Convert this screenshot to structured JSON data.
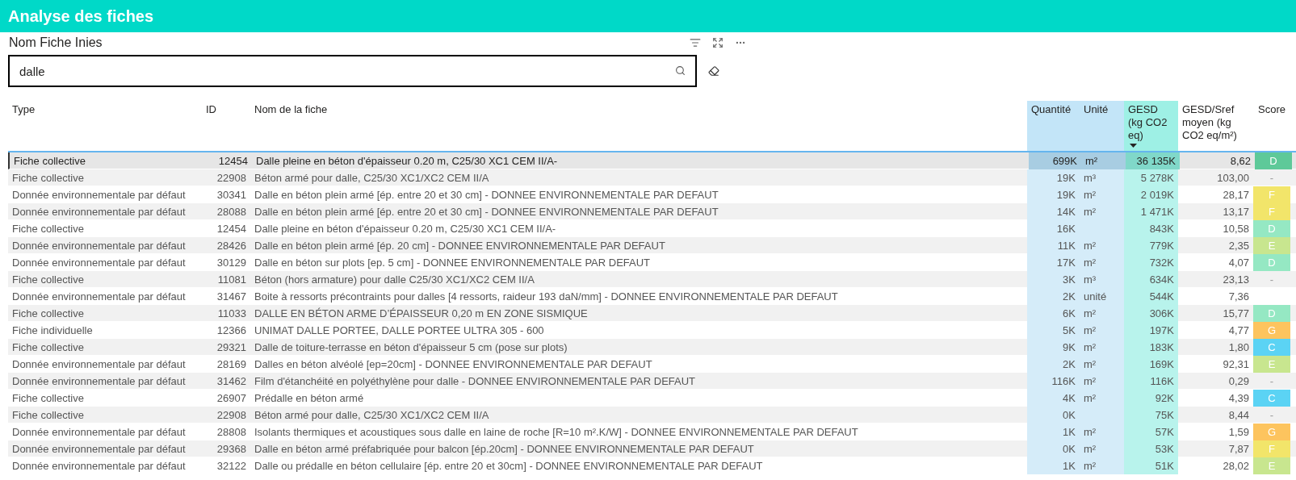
{
  "header": {
    "title": "Analyse des fiches"
  },
  "slicer": {
    "title": "Nom Fiche Inies",
    "search": {
      "value": "dalle"
    }
  },
  "table": {
    "columns": [
      {
        "label": "Type",
        "kind": "plain",
        "sorted": false
      },
      {
        "label": "ID",
        "kind": "number",
        "sorted": false
      },
      {
        "label": "Nom de la fiche",
        "kind": "plain",
        "sorted": false
      },
      {
        "label": "Quantité",
        "kind": "blue-number",
        "sorted": false
      },
      {
        "label": "Unité",
        "kind": "blue",
        "sorted": false
      },
      {
        "label": "GESD (kg CO2 eq)",
        "kind": "teal-number",
        "sorted": true
      },
      {
        "label": "GESD/Sref moyen (kg CO2 eq/m²)",
        "kind": "number",
        "sorted": false
      },
      {
        "label": "Score",
        "kind": "score",
        "sorted": false
      }
    ],
    "rows": [
      {
        "selected": true,
        "cells": [
          "Fiche collective",
          "12454",
          "Dalle pleine en béton d'épaisseur 0.20 m, C25/30 XC1 CEM II/A-",
          "699K",
          "m²",
          "36 135K",
          "8,62"
        ],
        "score": {
          "label": "D",
          "color": "#5ec999"
        }
      },
      {
        "selected": false,
        "cells": [
          "Fiche collective",
          "22908",
          "Béton armé pour dalle, C25/30 XC1/XC2 CEM II/A",
          "19K",
          "m³",
          "5 278K",
          "103,00"
        ],
        "score": {
          "label": "-"
        }
      },
      {
        "selected": false,
        "cells": [
          "Donnée environnementale par défaut",
          "30341",
          "Dalle en béton plein armé [ép. entre 20 et 30 cm] - DONNEE ENVIRONNEMENTALE PAR DEFAUT",
          "19K",
          "m²",
          "2 019K",
          "28,17"
        ],
        "score": {
          "label": "F",
          "color": "#f2e56a"
        }
      },
      {
        "selected": false,
        "cells": [
          "Donnée environnementale par défaut",
          "28088",
          "Dalle en béton plein armé [ép. entre 20 et 30 cm] - DONNEE ENVIRONNEMENTALE PAR DEFAUT",
          "14K",
          "m²",
          "1 471K",
          "13,17"
        ],
        "score": {
          "label": "F",
          "color": "#f2e56a"
        }
      },
      {
        "selected": false,
        "cells": [
          "Fiche collective",
          "12454",
          "Dalle pleine en béton d'épaisseur 0.20 m, C25/30 XC1 CEM II/A-",
          "16K",
          "",
          "843K",
          "10,58"
        ],
        "score": {
          "label": "D",
          "color": "#95e8c3"
        }
      },
      {
        "selected": false,
        "cells": [
          "Donnée environnementale par défaut",
          "28426",
          "Dalle en béton plein armé [ép. 20 cm] - DONNEE ENVIRONNEMENTALE PAR DEFAUT",
          "11K",
          "m²",
          "779K",
          "2,35"
        ],
        "score": {
          "label": "E",
          "color": "#c8e68f"
        }
      },
      {
        "selected": false,
        "cells": [
          "Donnée environnementale par défaut",
          "30129",
          "Dalle en béton sur plots [ep. 5 cm] - DONNEE ENVIRONNEMENTALE PAR DEFAUT",
          "17K",
          "m²",
          "732K",
          "4,07"
        ],
        "score": {
          "label": "D",
          "color": "#95e8c3"
        }
      },
      {
        "selected": false,
        "cells": [
          "Fiche collective",
          "11081",
          "Béton (hors armature) pour dalle C25/30 XC1/XC2 CEM II/A",
          "3K",
          "m³",
          "634K",
          "23,13"
        ],
        "score": {
          "label": "-"
        }
      },
      {
        "selected": false,
        "cells": [
          "Donnée environnementale par défaut",
          "31467",
          "Boite à ressorts précontraints pour dalles [4 ressorts, raideur 193 daN/mm] - DONNEE ENVIRONNEMENTALE PAR DEFAUT",
          "2K",
          "unité",
          "544K",
          "7,36"
        ]
      },
      {
        "selected": false,
        "cells": [
          "Fiche collective",
          "11033",
          "DALLE EN BÉTON ARME D’ÉPAISSEUR 0,20 m EN ZONE SISMIQUE",
          "6K",
          "m²",
          "306K",
          "15,77"
        ],
        "score": {
          "label": "D",
          "color": "#95e8c3"
        }
      },
      {
        "selected": false,
        "cells": [
          "Fiche individuelle",
          "12366",
          "UNIMAT DALLE PORTEE, DALLE PORTEE ULTRA 305 - 600",
          "5K",
          "m²",
          "197K",
          "4,77"
        ],
        "score": {
          "label": "G",
          "color": "#fdc45e"
        }
      },
      {
        "selected": false,
        "cells": [
          "Fiche collective",
          "29321",
          "Dalle de toiture-terrasse en béton d'épaisseur 5 cm (pose sur plots)",
          "9K",
          "m²",
          "183K",
          "1,80"
        ],
        "score": {
          "label": "C",
          "color": "#5bd3f4"
        }
      },
      {
        "selected": false,
        "cells": [
          "Donnée environnementale par défaut",
          "28169",
          "Dalles en béton alvéolé [ep=20cm] - DONNEE ENVIRONNEMENTALE PAR DEFAUT",
          "2K",
          "m²",
          "169K",
          "92,31"
        ],
        "score": {
          "label": "E",
          "color": "#c8e68f"
        }
      },
      {
        "selected": false,
        "cells": [
          "Donnée environnementale par défaut",
          "31462",
          "Film d'étanchéité en polyéthylène pour dalle - DONNEE ENVIRONNEMENTALE PAR DEFAUT",
          "116K",
          "m²",
          "116K",
          "0,29"
        ],
        "score": {
          "label": "-"
        }
      },
      {
        "selected": false,
        "cells": [
          "Fiche collective",
          "26907",
          "Prédalle en béton armé",
          "4K",
          "m²",
          "92K",
          "4,39"
        ],
        "score": {
          "label": "C",
          "color": "#5bd3f4"
        }
      },
      {
        "selected": false,
        "cells": [
          "Fiche collective",
          "22908",
          "Béton armé pour dalle, C25/30 XC1/XC2 CEM II/A",
          "0K",
          "",
          "75K",
          "8,44"
        ],
        "score": {
          "label": "-"
        }
      },
      {
        "selected": false,
        "cells": [
          "Donnée environnementale par défaut",
          "28808",
          "Isolants thermiques et acoustiques sous dalle en laine de roche [R=10 m².K/W] - DONNEE ENVIRONNEMENTALE PAR DEFAUT",
          "1K",
          "m²",
          "57K",
          "1,59"
        ],
        "score": {
          "label": "G",
          "color": "#fdc45e"
        }
      },
      {
        "selected": false,
        "cells": [
          "Donnée environnementale par défaut",
          "29368",
          "Dalle en béton armé préfabriquée pour balcon [ép.20cm] - DONNEE ENVIRONNEMENTALE PAR DEFAUT",
          "0K",
          "m²",
          "53K",
          "7,87"
        ],
        "score": {
          "label": "F",
          "color": "#f2e56a"
        }
      },
      {
        "selected": false,
        "cells": [
          "Donnée environnementale par défaut",
          "32122",
          "Dalle ou prédalle en béton cellulaire [ép. entre 20 et 30cm] - DONNEE ENVIRONNEMENTALE PAR DEFAUT",
          "1K",
          "m²",
          "51K",
          "28,02"
        ],
        "score": {
          "label": "E",
          "color": "#c8e68f"
        }
      }
    ]
  }
}
